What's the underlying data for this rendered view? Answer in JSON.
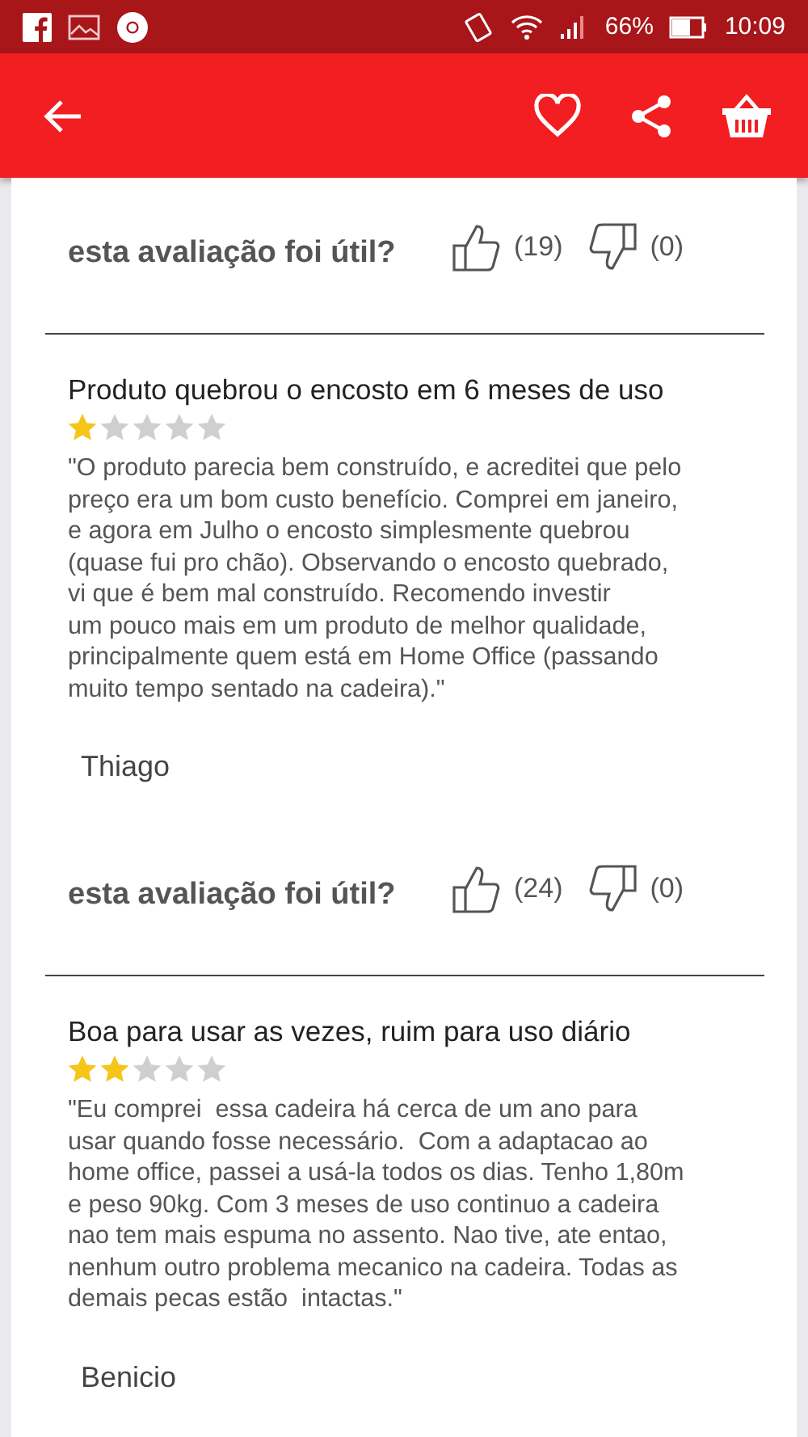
{
  "status_bar": {
    "battery": "66%",
    "time": "10:09"
  },
  "top_helpful": {
    "question": "esta avaliação foi útil?",
    "likes": "(19)",
    "dislikes": "(0)"
  },
  "reviews": [
    {
      "title": "Produto quebrou o encosto em 6 meses de uso",
      "stars": 1,
      "body": "\"O produto parecia bem construído, e acreditei que pelo\npreço era um bom custo benefício. Comprei em janeiro,\ne agora em Julho o encosto simplesmente quebrou\n(quase fui pro chão). Observando o encosto quebrado,\nvi que é bem mal construído. Recomendo investir\num pouco mais em um produto de melhor qualidade,\nprincipalmente quem está em Home Office (passando\nmuito tempo sentado na cadeira).\"",
      "author": "Thiago",
      "helpful": {
        "question": "esta avaliação foi útil?",
        "likes": "(24)",
        "dislikes": "(0)"
      }
    },
    {
      "title": "Boa para usar as vezes, ruim para uso diário",
      "stars": 2,
      "body": "\"Eu comprei  essa cadeira há cerca de um ano para\nusar quando fosse necessário.  Com a adaptacao ao\nhome office, passei a usá-la todos os dias. Tenho 1,80m\ne peso 90kg. Com 3 meses de uso continuo a cadeira\nnao tem mais espuma no assento. Nao tive, ate entao,\nnenhum outro problema mecanico na cadeira. Todas as\ndemais pecas estão  intactas.\"",
      "author": "Benicio"
    }
  ]
}
